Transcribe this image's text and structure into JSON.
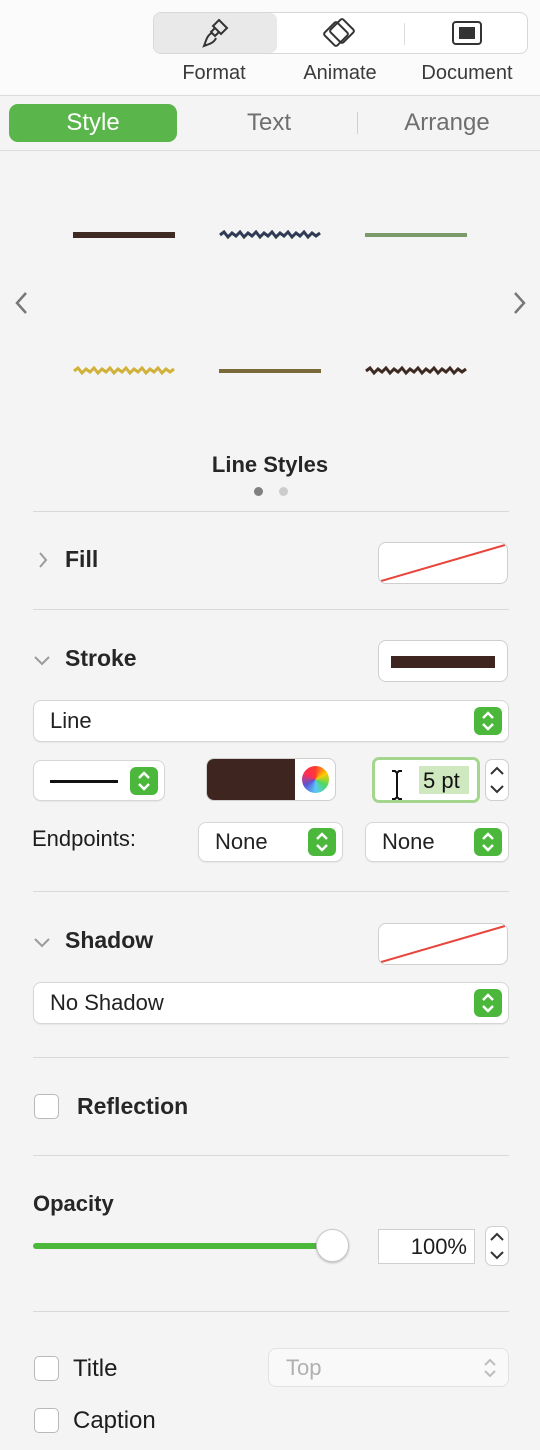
{
  "toolbar": {
    "format_label": "Format",
    "animate_label": "Animate",
    "document_label": "Document"
  },
  "tabs": {
    "style": "Style",
    "text": "Text",
    "arrange": "Arrange"
  },
  "line_styles": {
    "title": "Line Styles",
    "items": [
      {
        "name": "solid-dark-brown",
        "color": "#3e2a22",
        "texture": "solid"
      },
      {
        "name": "rough-navy",
        "color": "#2f3b55",
        "texture": "rough"
      },
      {
        "name": "solid-sage-green",
        "color": "#7a9a6a",
        "texture": "solid"
      },
      {
        "name": "rough-gold",
        "color": "#d0b23a",
        "texture": "rough"
      },
      {
        "name": "solid-olive",
        "color": "#7a6a3a",
        "texture": "solid"
      },
      {
        "name": "rough-dark-brown",
        "color": "#3e2a22",
        "texture": "rough"
      }
    ],
    "page_count": 2,
    "current_page": 1
  },
  "fill": {
    "label": "Fill",
    "swatch": "none"
  },
  "stroke": {
    "label": "Stroke",
    "swatch_color": "#3e2520",
    "type_value": "Line",
    "color": "#3e2520",
    "width_value": "5 pt",
    "endpoints_label": "Endpoints:",
    "endpoint_start": "None",
    "endpoint_end": "None"
  },
  "shadow": {
    "label": "Shadow",
    "value": "No Shadow"
  },
  "reflection": {
    "label": "Reflection",
    "checked": false
  },
  "opacity": {
    "label": "Opacity",
    "value": "100%",
    "level": 1.0
  },
  "title_option": {
    "label": "Title",
    "position": "Top"
  },
  "caption_option": {
    "label": "Caption"
  },
  "colors": {
    "accent": "#5ab54b",
    "none_slash": "#e8453c"
  }
}
